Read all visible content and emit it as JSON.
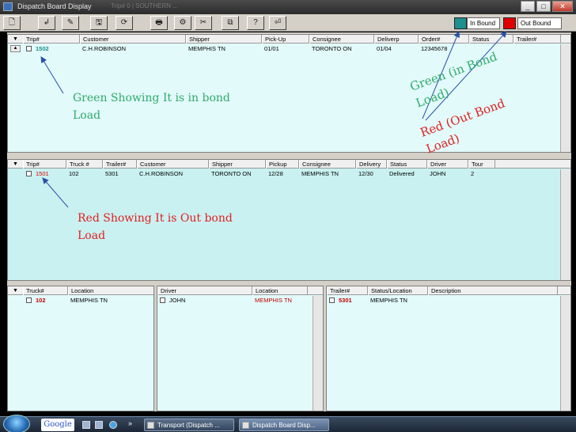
{
  "window": {
    "title": "Dispatch Board Display",
    "faint_title": "Trip# 0 | SOUTHERN ...",
    "controls": [
      "_",
      "□",
      "✕"
    ]
  },
  "toolbar": {
    "icons": [
      "new-icon",
      "open-icon",
      "edit-icon",
      "save-icon",
      "refresh-icon",
      "print-icon",
      "config-icon",
      "cut-icon",
      "copy-icon",
      "help-icon",
      "exit-icon"
    ],
    "glyphs": [
      "🗋",
      "↲",
      "✎",
      "🖫",
      "⟳",
      "🖶",
      "⚙",
      "✂",
      "⧉",
      "?",
      "⏎"
    ],
    "legend_inbound_label": "In Bound",
    "legend_outbound_label": "Out Bound",
    "colors": {
      "inbound": "#1f8f8f",
      "outbound": "#e00000"
    }
  },
  "trips_grid": {
    "columns": [
      "Trip#",
      "Customer",
      "Shipper",
      "Pick-Up",
      "Consignee",
      "Deliverp",
      "Order#",
      "Status",
      "Trailer#"
    ],
    "rows": [
      {
        "trip": "1502",
        "customer": "C.H.ROBINSON",
        "shipper": "MEMPHIS TN",
        "pickup": "01/01",
        "consignee": "TORONTO ON",
        "delivery": "01/04",
        "order": "12345678",
        "status": "",
        "trailer": ""
      }
    ]
  },
  "dispatch_grid": {
    "columns": [
      "Trip#",
      "Truck #",
      "Trailer#",
      "Customer",
      "Shipper",
      "Pickup",
      "Consignee",
      "Delivery",
      "Status",
      "Driver",
      "Tour"
    ],
    "rows": [
      {
        "trip": "1501",
        "truck": "102",
        "trailer": "5301",
        "customer": "C.H.ROBINSON",
        "shipper": "TORONTO ON",
        "pickup": "12/28",
        "consignee": "MEMPHIS TN",
        "delivery": "12/30",
        "status": "Delivered",
        "driver": "JOHN",
        "tour": "2"
      }
    ]
  },
  "trucks_grid": {
    "columns": [
      "Truck#",
      "Location"
    ],
    "rows": [
      {
        "truck": "102",
        "location": "MEMPHIS TN"
      }
    ]
  },
  "drivers_grid": {
    "columns": [
      "Driver",
      "Location"
    ],
    "rows": [
      {
        "driver": "JOHN",
        "location": "MEMPHIS TN"
      }
    ]
  },
  "trailers_grid": {
    "columns": [
      "Trailer#",
      "Status/Location",
      "Description"
    ],
    "rows": [
      {
        "trailer": "5301",
        "status_location": "MEMPHIS TN",
        "description": ""
      }
    ]
  },
  "annotations": {
    "green_note": "Green Showing It is in bond\nLoad",
    "red_note": "Red Showing It is Out bond\nLoad",
    "green_legend_note": "Green (in Bond\nLoad)",
    "red_legend_note": "Red (Out Bond\nLoad)"
  },
  "taskbar": {
    "search_label": "Google",
    "overflow": "»",
    "items": [
      "Transport (Dispatch ...",
      "Dispatch Board Disp..."
    ]
  }
}
